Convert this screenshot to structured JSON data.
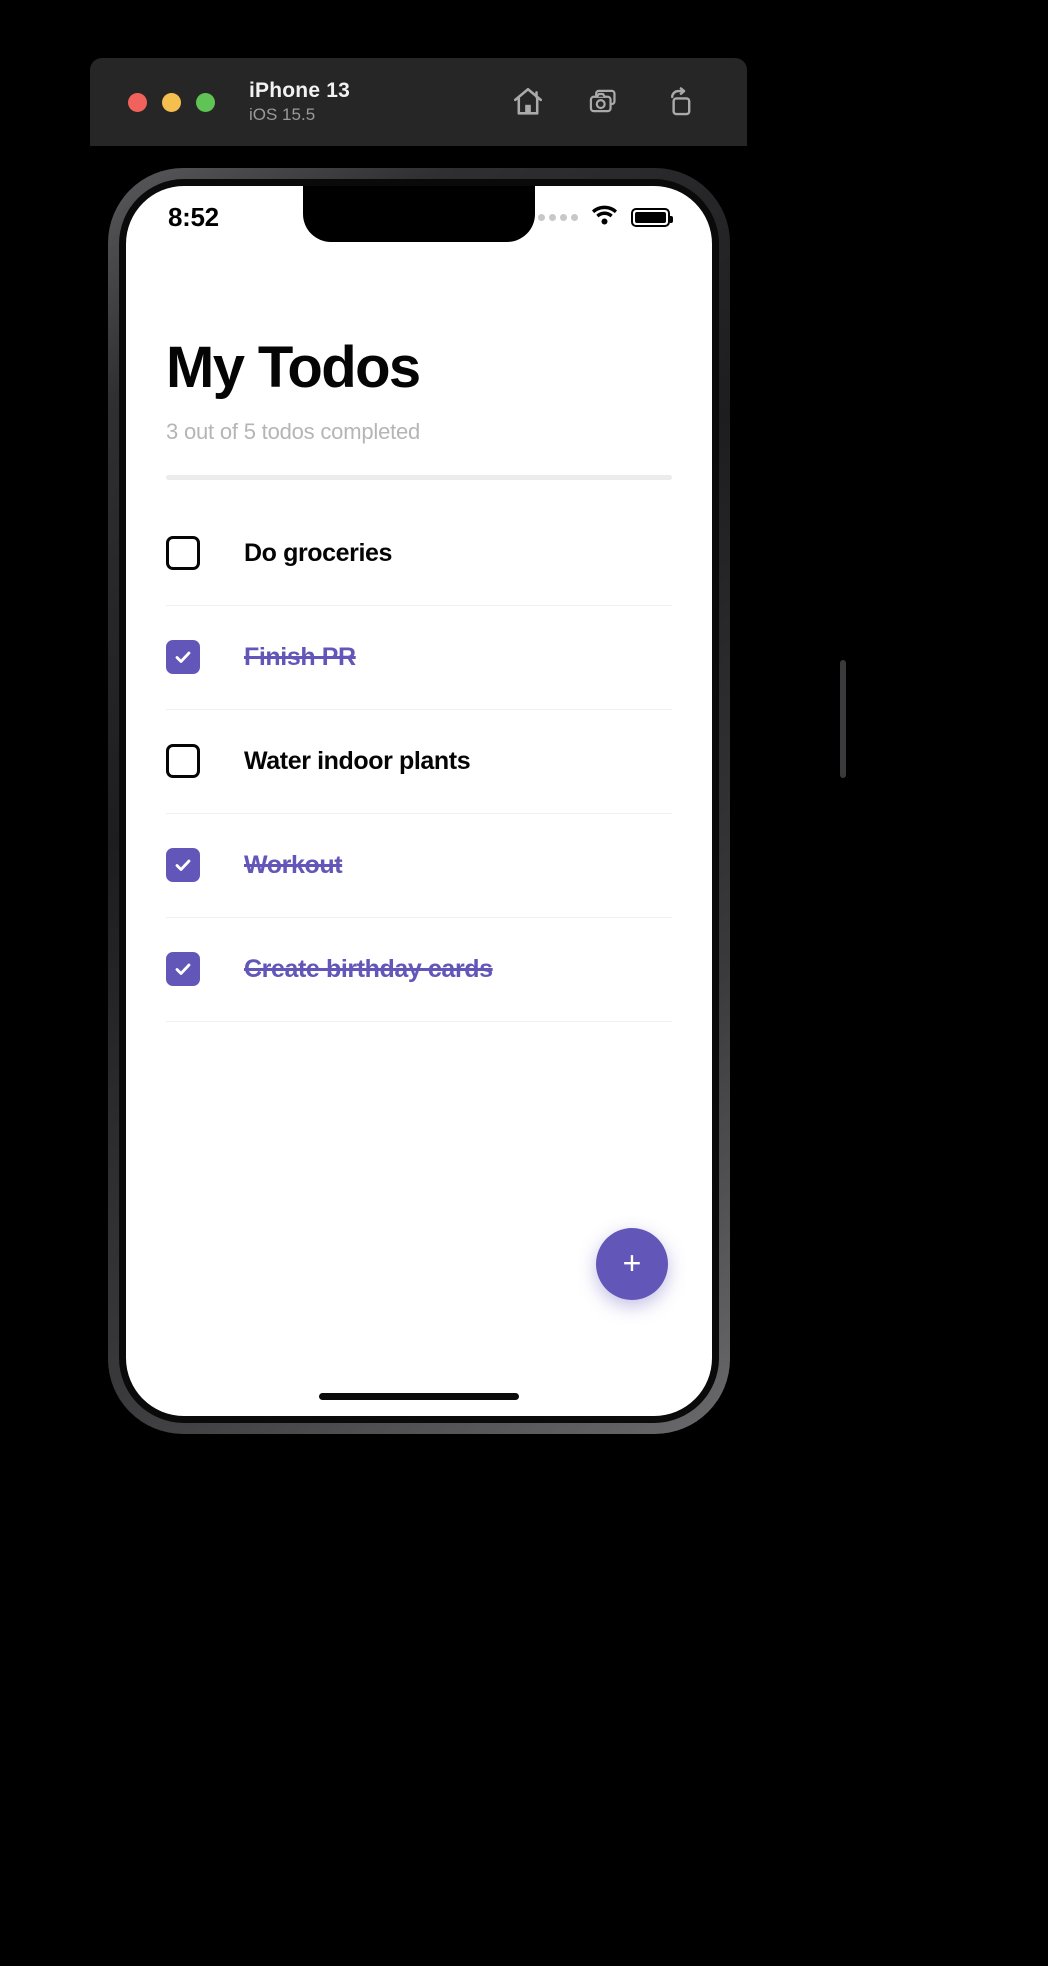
{
  "simulator": {
    "device_name": "iPhone 13",
    "os_version": "iOS 15.5",
    "window_controls": [
      {
        "name": "close",
        "color": "#f2625c"
      },
      {
        "name": "minimize",
        "color": "#f4bf4f"
      },
      {
        "name": "zoom",
        "color": "#5fc455"
      }
    ],
    "actions": [
      {
        "name": "home-icon",
        "label": "Home"
      },
      {
        "name": "screenshot-icon",
        "label": "Screenshot"
      },
      {
        "name": "rotate-icon",
        "label": "Rotate"
      }
    ]
  },
  "status_bar": {
    "time": "8:52",
    "cellular_icon": "signal-dots-icon",
    "wifi_icon": "wifi-icon",
    "battery_icon": "battery-full-icon"
  },
  "app": {
    "title": "My Todos",
    "subtitle": "3 out of 5 todos completed",
    "completed_count": 3,
    "total_count": 5,
    "accent_color": "#6257b8",
    "add_button_label": "+",
    "todos": [
      {
        "label": "Do groceries",
        "done": false
      },
      {
        "label": "Finish PR",
        "done": true
      },
      {
        "label": "Water indoor plants",
        "done": false
      },
      {
        "label": "Workout",
        "done": true
      },
      {
        "label": "Create birthday cards",
        "done": true
      }
    ]
  }
}
